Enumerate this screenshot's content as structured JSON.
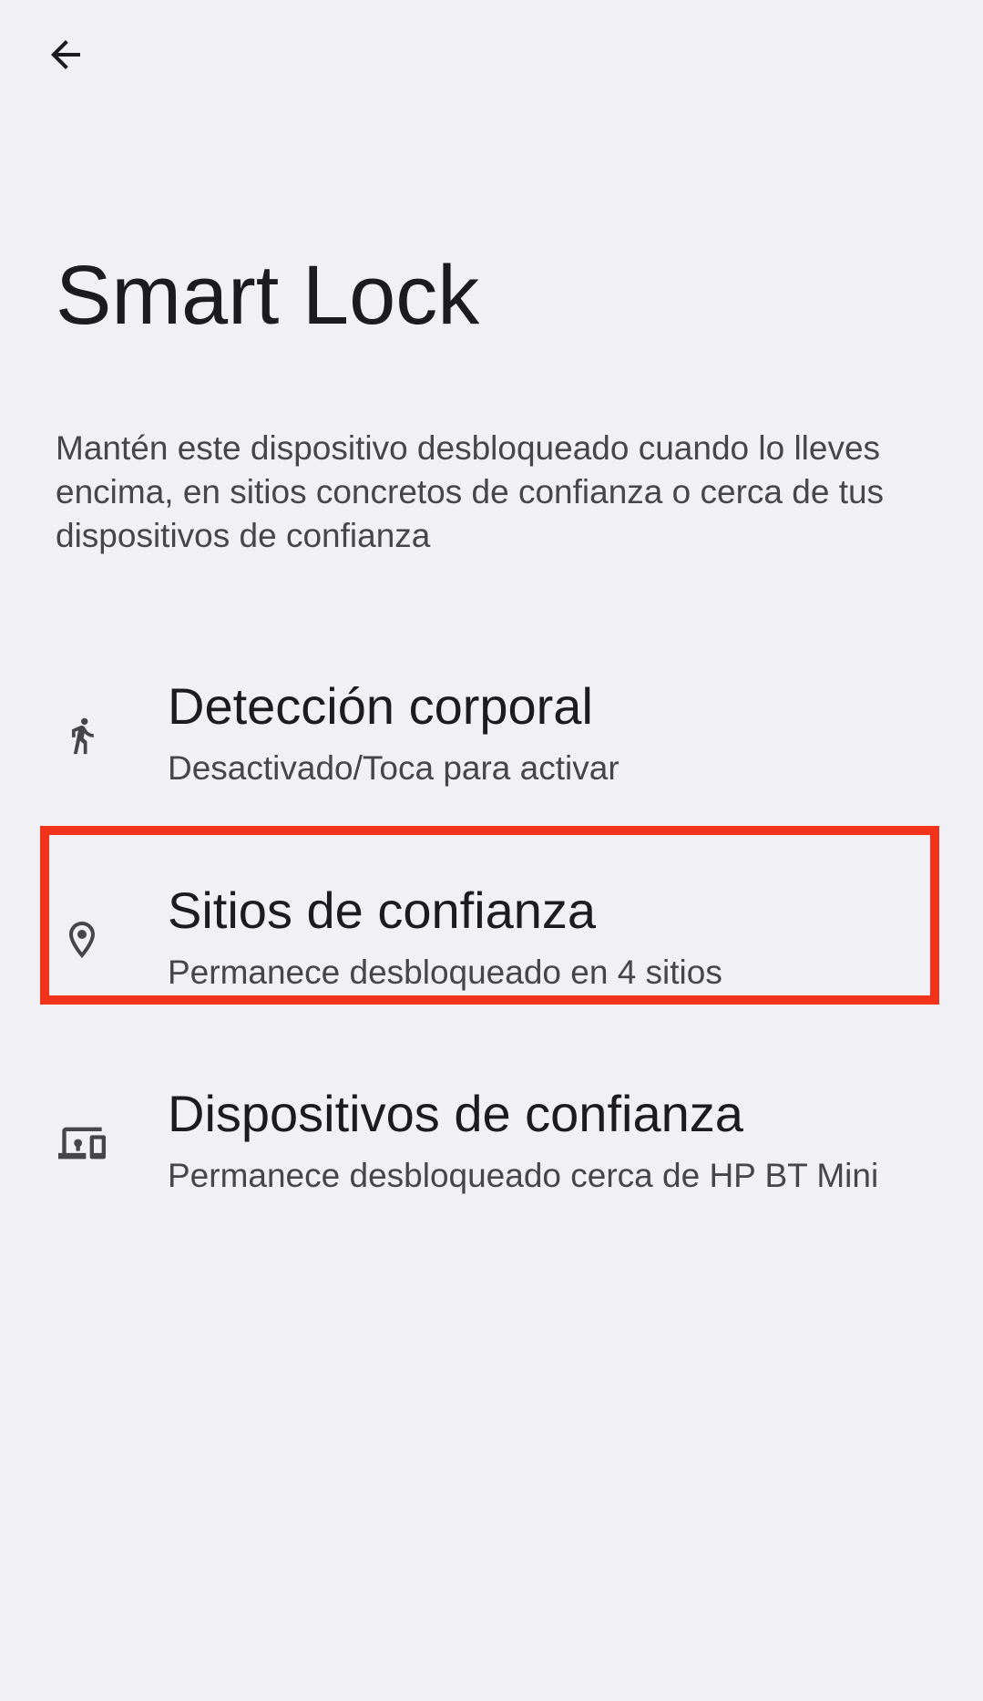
{
  "header": {
    "back_icon": "arrow-back-icon",
    "title": "Smart Lock"
  },
  "description": "Mantén este dispositivo desbloqueado cuando lo lleves encima, en sitios concretos de confianza o cerca de tus dispositivos de confianza",
  "items": [
    {
      "icon": "walking-person-icon",
      "title": "Detección corporal",
      "summary": "Desactivado/Toca para activar"
    },
    {
      "icon": "location-pin-icon",
      "title": "Sitios de confianza",
      "summary": "Permanece desbloqueado en 4 sitios"
    },
    {
      "icon": "devices-icon",
      "title": "Dispositivos de confianza",
      "summary": "Permanece desbloqueado cerca de HP BT Mini"
    }
  ],
  "highlight": {
    "color": "#f2331c",
    "target": "Sitios de confianza"
  },
  "colors": {
    "background": "#f1f0f5",
    "text_primary": "#1c1b1f",
    "text_secondary": "#46454a"
  }
}
